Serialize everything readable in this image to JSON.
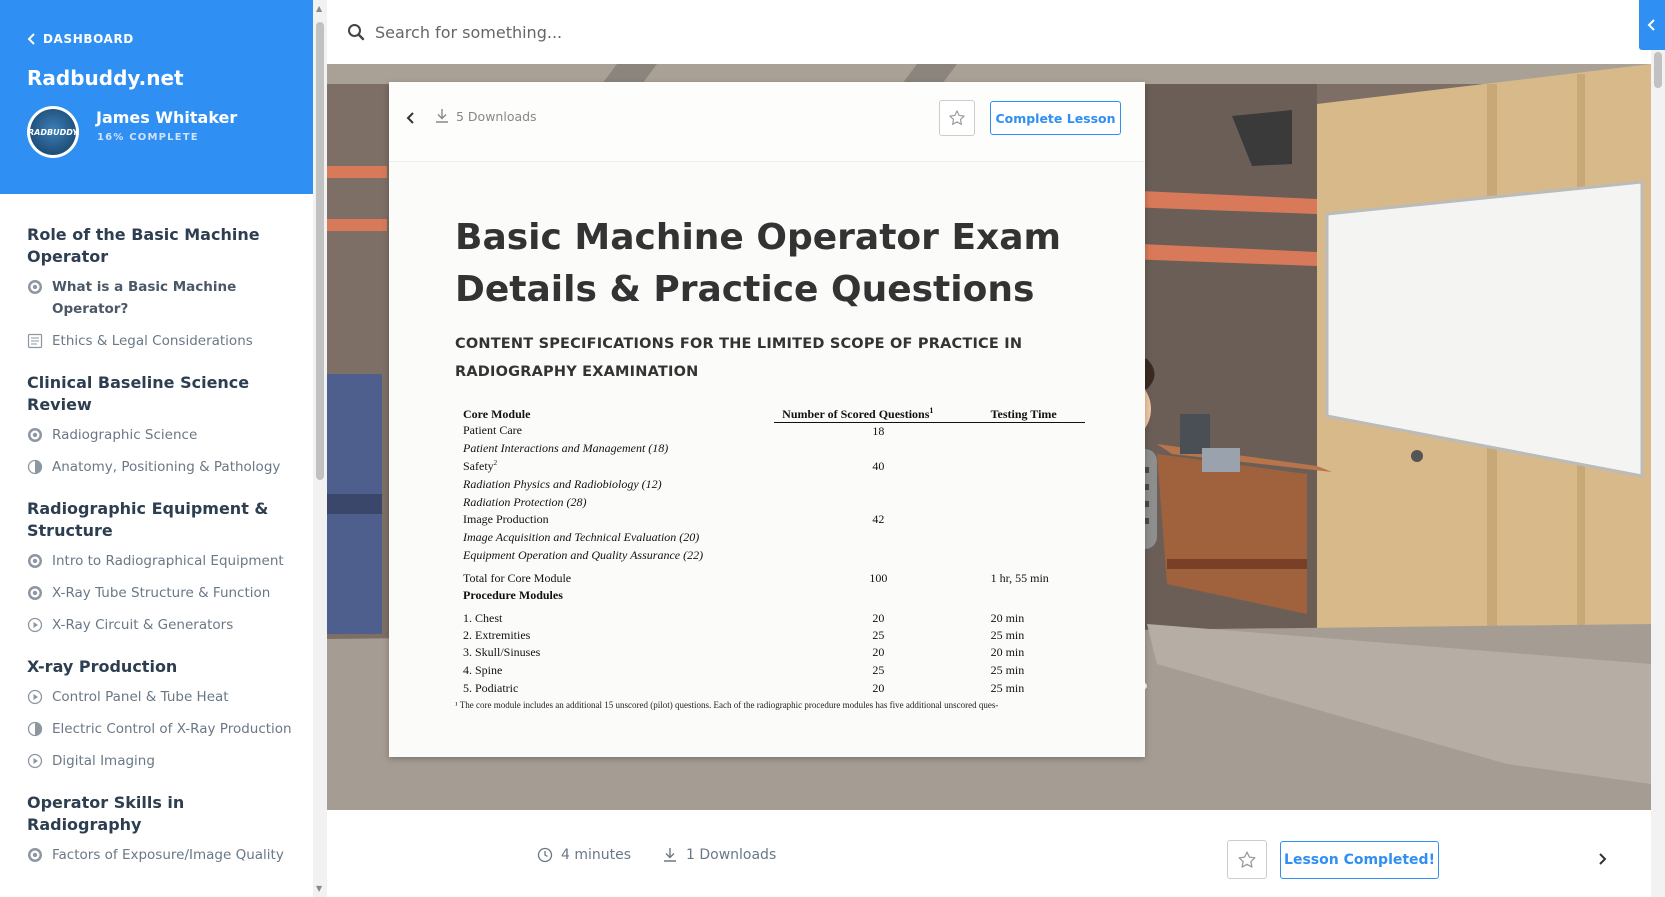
{
  "sidebar": {
    "back_label": "DASHBOARD",
    "site_name": "Radbuddy.net",
    "user": {
      "name": "James Whitaker",
      "progress": "16% COMPLETE",
      "avatar_text": "RADBUDDY"
    },
    "sections": [
      {
        "title": "Role of the Basic Machine Operator",
        "lessons": [
          {
            "label": "What is a Basic Machine Operator?",
            "icon": "video-icon",
            "active": true
          },
          {
            "label": "Ethics & Legal Considerations",
            "icon": "document-icon"
          }
        ]
      },
      {
        "title": "Clinical Baseline Science Review",
        "lessons": [
          {
            "label": "Radiographic Science",
            "icon": "video-icon"
          },
          {
            "label": "Anatomy, Positioning & Pathology",
            "icon": "half-circle-icon"
          }
        ]
      },
      {
        "title": "Radiographic Equipment & Structure",
        "lessons": [
          {
            "label": "Intro to Radiographical Equipment",
            "icon": "video-icon"
          },
          {
            "label": "X-Ray Tube Structure & Function",
            "icon": "video-icon"
          },
          {
            "label": "X-Ray Circuit & Generators",
            "icon": "play-icon"
          }
        ]
      },
      {
        "title": "X-ray Production",
        "lessons": [
          {
            "label": "Control Panel & Tube Heat",
            "icon": "play-icon"
          },
          {
            "label": "Electric Control of X-Ray Production",
            "icon": "half-circle-icon"
          },
          {
            "label": "Digital Imaging",
            "icon": "play-icon"
          }
        ]
      },
      {
        "title": "Operator Skills in Radiography",
        "lessons": [
          {
            "label": "Factors of Exposure/Image Quality",
            "icon": "video-icon"
          }
        ]
      }
    ]
  },
  "search": {
    "placeholder": "Search for something..."
  },
  "document": {
    "downloads": "5 Downloads",
    "complete_label": "Complete Lesson",
    "title": "Basic Machine Operator Exam Details & Practice Questions",
    "subtitle": "CONTENT SPECIFICATIONS FOR THE LIMITED SCOPE OF PRACTICE IN RADIOGRAPHY EXAMINATION",
    "table": {
      "headers": {
        "module": "Core Module",
        "questions": "Number of Scored Questions",
        "questions_sup": "1",
        "time": "Testing Time"
      },
      "rows": [
        {
          "module": "Patient Care",
          "q": "18",
          "t": "",
          "style": ""
        },
        {
          "module": "Patient Interactions and Management (18)",
          "q": "",
          "t": "",
          "style": "sub"
        },
        {
          "module": "Safety",
          "sup": "2",
          "q": "40",
          "t": "",
          "style": ""
        },
        {
          "module": "Radiation Physics and Radiobiology (12)",
          "q": "",
          "t": "",
          "style": "sub"
        },
        {
          "module": "Radiation Protection (28)",
          "q": "",
          "t": "",
          "style": "sub"
        },
        {
          "module": "Image Production",
          "q": "42",
          "t": "",
          "style": ""
        },
        {
          "module": "Image Acquisition and Technical Evaluation (20)",
          "q": "",
          "t": "",
          "style": "sub"
        },
        {
          "module": "Equipment Operation and Quality Assurance (22)",
          "q": "",
          "t": "",
          "style": "sub"
        },
        {
          "module": "Total for Core Module",
          "q": "100",
          "t": "1 hr, 55 min",
          "style": "gap"
        },
        {
          "module": "Procedure Modules",
          "q": "",
          "t": "",
          "style": "bold"
        },
        {
          "module": "1.  Chest",
          "q": "20",
          "t": "20 min",
          "style": "gap"
        },
        {
          "module": "2.  Extremities",
          "q": "25",
          "t": "25 min",
          "style": ""
        },
        {
          "module": "3.  Skull/Sinuses",
          "q": "20",
          "t": "20 min",
          "style": ""
        },
        {
          "module": "4.  Spine",
          "q": "25",
          "t": "25 min",
          "style": ""
        },
        {
          "module": "5.  Podiatric",
          "q": "20",
          "t": "25 min",
          "style": ""
        }
      ],
      "footnote": "¹ The core module includes an additional 15 unscored (pilot) questions. Each of the radiographic procedure modules has five additional unscored ques-"
    }
  },
  "lesson_footer": {
    "duration": "4 minutes",
    "downloads": "1 Downloads",
    "completed_label": "Lesson Completed!"
  },
  "colors": {
    "accent": "#2f8ff2",
    "text": "#2d3e50",
    "muted": "#6a7886"
  }
}
